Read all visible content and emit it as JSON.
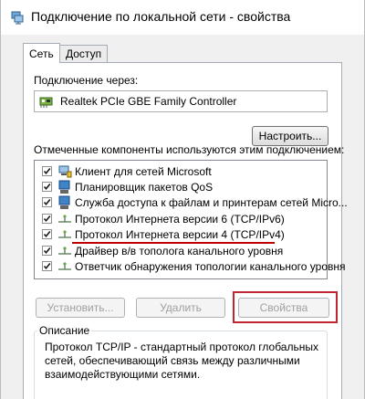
{
  "window": {
    "title": "Подключение по локальной сети - свойства",
    "icon": "network-icon"
  },
  "tabs": [
    {
      "label": "Сеть",
      "active": true
    },
    {
      "label": "Доступ",
      "active": false
    }
  ],
  "connection": {
    "connect_using_label": "Подключение через:",
    "adapter_name": "Realtek PCIe GBE Family Controller",
    "adapter_icon": "network-adapter-icon",
    "configure_button": "Настроить..."
  },
  "components": {
    "header": "Отмеченные компоненты используются этим подключением:",
    "items": [
      {
        "label": "Клиент для сетей Microsoft",
        "checked": true,
        "icon": "network-client-icon"
      },
      {
        "label": "Планировщик пакетов QoS",
        "checked": true,
        "icon": "service-icon"
      },
      {
        "label": "Служба доступа к файлам и принтерам сетей Micro...",
        "checked": true,
        "icon": "service-icon"
      },
      {
        "label": "Протокол Интернета версии 6 (TCP/IPv6)",
        "checked": true,
        "icon": "protocol-icon"
      },
      {
        "label": "Протокол Интернета версии 4 (TCP/IPv4)",
        "checked": true,
        "icon": "protocol-icon"
      },
      {
        "label": "Драйвер в/в тополога канального уровня",
        "checked": true,
        "icon": "protocol-icon"
      },
      {
        "label": "Ответчик обнаружения топологии канального уровня",
        "checked": true,
        "icon": "protocol-icon"
      }
    ]
  },
  "buttons": {
    "install": "Установить...",
    "uninstall": "Удалить",
    "properties": "Свойства"
  },
  "description": {
    "title": "Описание",
    "text": "Протокол TCP/IP - стандартный протокол глобальных\nсетей, обеспечивающий связь между различными\nвзаимодействующими сетями."
  },
  "colors": {
    "annotation": "#c0262e",
    "accent": "#1f6fd1"
  }
}
